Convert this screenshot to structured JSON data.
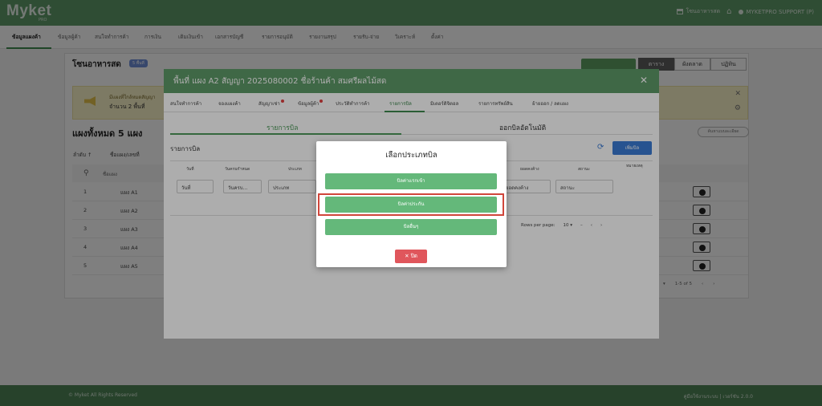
{
  "app": {
    "logo": "Myket",
    "logo_sub": "PRO",
    "topbar": {
      "store_label": "โซนอาหารสด",
      "user_label": "MYKETPRO SUPPORT (P)"
    }
  },
  "menu": [
    "ข้อมูลแผงค้า",
    "ข้อมูลผู้ค้า",
    "สนใจทำการค้า",
    "การเงิน",
    "เติมเงินเข้า",
    "เอกสารบัญชี",
    "รายการอนุมัติ",
    "รายงานสรุป",
    "รายรับ-จ่าย",
    "วิเคราะห์",
    "ตั้งค่า"
  ],
  "page": {
    "zone_title": "โซนอาหารสด",
    "zone_badge": "5 พื้นที่",
    "right_tabs": [
      "ตาราง",
      "ผังตลาด",
      "ปฏิทิน"
    ],
    "notice_line1": "มีแผงที่ใกล้หมดสัญญา",
    "notice_line2": "จำนวน 2 พื้นที่",
    "list_title": "แผงทั้งหมด 5 แผง",
    "search_label": "ค้นหาแบบละเอียด",
    "col_order": "ลำดับ ↑",
    "col_name": "ชื่อแผง/เลขที่",
    "filter_placeholder": "ชื่อแผง",
    "rows": [
      {
        "no": "1",
        "name": "แผง A1"
      },
      {
        "no": "2",
        "name": "แผง A2"
      },
      {
        "no": "3",
        "name": "แผง A3"
      },
      {
        "no": "4",
        "name": "แผง A4"
      },
      {
        "no": "5",
        "name": "แผง A5"
      }
    ],
    "pager": "1-5 of 5"
  },
  "footer": {
    "copyright": "© Myket All Rights Reserved",
    "version": "คู่มือใช้งานระบบ | เวอร์ชัน 2.0.0"
  },
  "dialog": {
    "title": "พื้นที่ แผง A2 สัญญา 2025080002 ชื่อร้านค้า สมศรีผลไม้สด",
    "close": "✕",
    "tabs": [
      "สนใจทำการค้า",
      "จองแผงค้า",
      "สัญญาเช่า",
      "ข้อมูลผู้ค้า",
      "ประวัติทำการค้า",
      "รายการบิล",
      "มิเตอร์ดิจิตอล",
      "รายการทรัพย์สิน",
      "ย้ายออก / ลดแผง"
    ],
    "subtabs": [
      "รายการบิล",
      "ออกบิลอัตโนมัติ"
    ],
    "bill_label": "รายการบิล",
    "add_bill": "เพิ่มบิล",
    "headers": [
      "วันที่",
      "วันครบกำหนด",
      "ประเภท",
      "ยอดคงค้าง",
      "สถานะ",
      "หมายเหตุ"
    ],
    "filters": [
      "วันที่",
      "วันครบ...",
      "ประเภท",
      "ยอดคงค้าง",
      "สถานะ"
    ],
    "rows_per_page_label": "Rows per page:",
    "rows_per_page": "10",
    "pager_range": "–"
  },
  "bill_type_dialog": {
    "title": "เลือกประเภทบิล",
    "options": [
      "บิลค่าแรกเข้า",
      "บิลค่าประกัน",
      "บิลอื่นๆ"
    ],
    "close_label": "ปิด"
  }
}
